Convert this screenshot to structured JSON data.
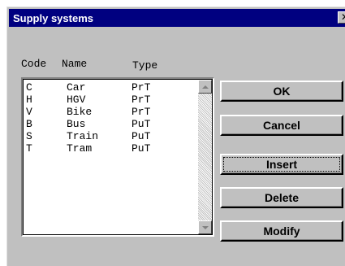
{
  "window": {
    "title": "Supply systems",
    "close_glyph": "✕"
  },
  "list": {
    "headers": {
      "code": "Code",
      "name": "Name",
      "type": "Type"
    },
    "rows": [
      {
        "code": "C",
        "name": "Car",
        "type": "PrT"
      },
      {
        "code": "H",
        "name": "HGV",
        "type": "PrT"
      },
      {
        "code": "V",
        "name": "Bike",
        "type": "PrT"
      },
      {
        "code": "B",
        "name": "Bus",
        "type": "PuT"
      },
      {
        "code": "S",
        "name": "Train",
        "type": "PuT"
      },
      {
        "code": "T",
        "name": "Tram",
        "type": "PuT"
      }
    ]
  },
  "buttons": {
    "ok": "OK",
    "cancel": "Cancel",
    "insert": "Insert",
    "delete": "Delete",
    "modify": "Modify"
  },
  "colors": {
    "titlebar": "#000080",
    "face": "#c0c0c0"
  }
}
